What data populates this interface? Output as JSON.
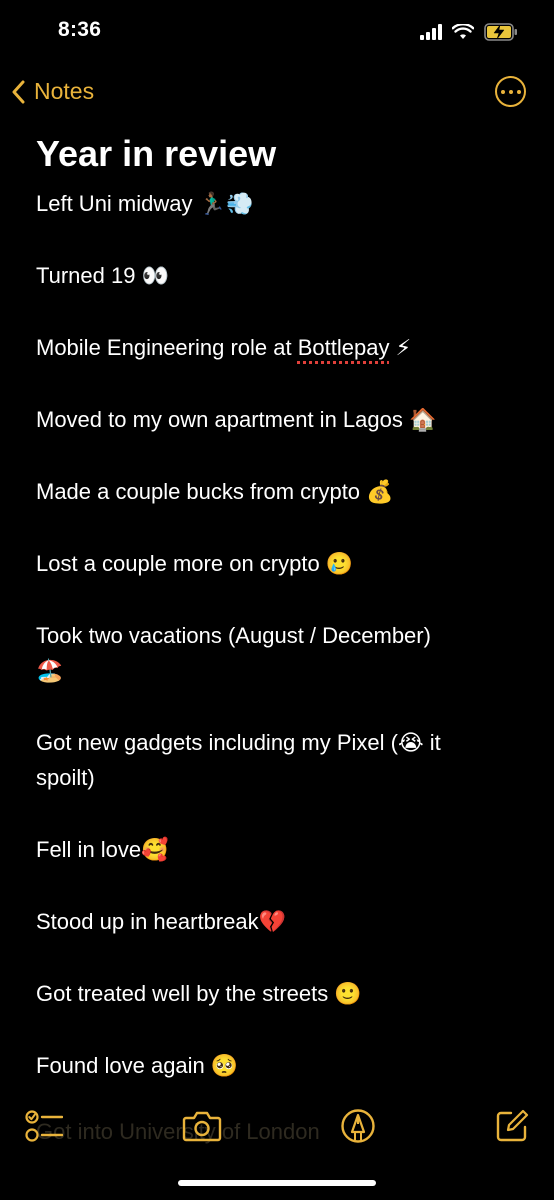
{
  "status": {
    "time": "8:36",
    "signal_icon": "cellular-signal-icon",
    "wifi_icon": "wifi-icon",
    "battery_icon": "battery-charging-icon"
  },
  "nav": {
    "back_label": "Notes",
    "back_icon": "chevron-left-icon",
    "more_icon": "more-options-icon"
  },
  "note": {
    "title": "Year in review",
    "entries": [
      "Left Uni midway 🏃🏾‍♂️💨",
      "Turned 19 👀",
      "Mobile Engineering role at ",
      "Moved to my own apartment in Lagos 🏠",
      "Made a couple bucks from crypto 💰",
      "Lost a couple more on crypto 🥲",
      "Took two vacations (August / December)",
      "🏖️",
      "Got new gadgets including my Pixel (😭 it",
      "spoilt)",
      "Fell in love🥰",
      "Stood up in heartbreak💔",
      "Got treated well by the streets 🙂",
      "Found love again 🥺"
    ],
    "misspelled_word": "Bottlepay",
    "after_misspelled": " ⚡",
    "peek_text": "Got into University of London"
  },
  "toolbar": {
    "checklist_icon": "checklist-icon",
    "camera_icon": "camera-icon",
    "markup_icon": "markup-pen-icon",
    "compose_icon": "compose-icon"
  },
  "colors": {
    "background": "#000000",
    "accent": "#e9b33b",
    "text": "#ffffff",
    "spellcheck": "#e0403a"
  }
}
